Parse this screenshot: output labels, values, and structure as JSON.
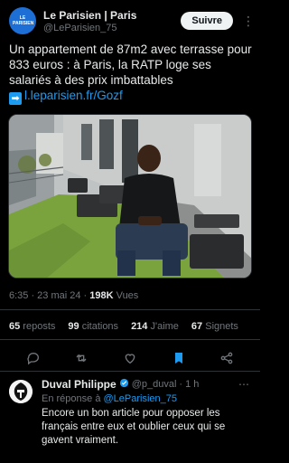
{
  "header": {
    "avatar_text": "LE PARISIEN",
    "name": "Le Parisien | Paris",
    "handle": "@LeParisien_75",
    "follow_label": "Suivre"
  },
  "tweet": {
    "text": "Un appartement de 87m2 avec terrasse pour 833 euros : à Paris, la RATP loge ses salariés à des prix imbattables",
    "link": "l.leparisien.fr/Gozf",
    "time": "6:35 · 23 mai 24 · ",
    "views_count": "198K",
    "views_label": " Vues"
  },
  "stats": {
    "reposts_count": "65",
    "reposts_label": " reposts",
    "quotes_count": "99",
    "quotes_label": " citations",
    "likes_count": "214",
    "likes_label": " J'aime",
    "bookmarks_count": "67",
    "bookmarks_label": " Signets"
  },
  "actions": {
    "reply_icon": "reply-icon",
    "repost_icon": "repost-icon",
    "like_icon": "heart-icon",
    "bookmark_icon": "bookmark-icon",
    "share_icon": "share-icon",
    "bookmark_color": "#1d9bf0"
  },
  "reply": {
    "name": "Duval Philippe",
    "handle": "@p_duval",
    "time": "· 1 h",
    "in_reply_prefix": "En réponse à ",
    "in_reply_mention": "@LeParisien_75",
    "text": "Encore un bon article pour opposer les français entre eux et oublier ceux qui se gavent vraiment."
  },
  "colors": {
    "background": "#000000",
    "accent": "#1d9bf0",
    "muted": "#71767b",
    "text": "#e7e9ea"
  }
}
